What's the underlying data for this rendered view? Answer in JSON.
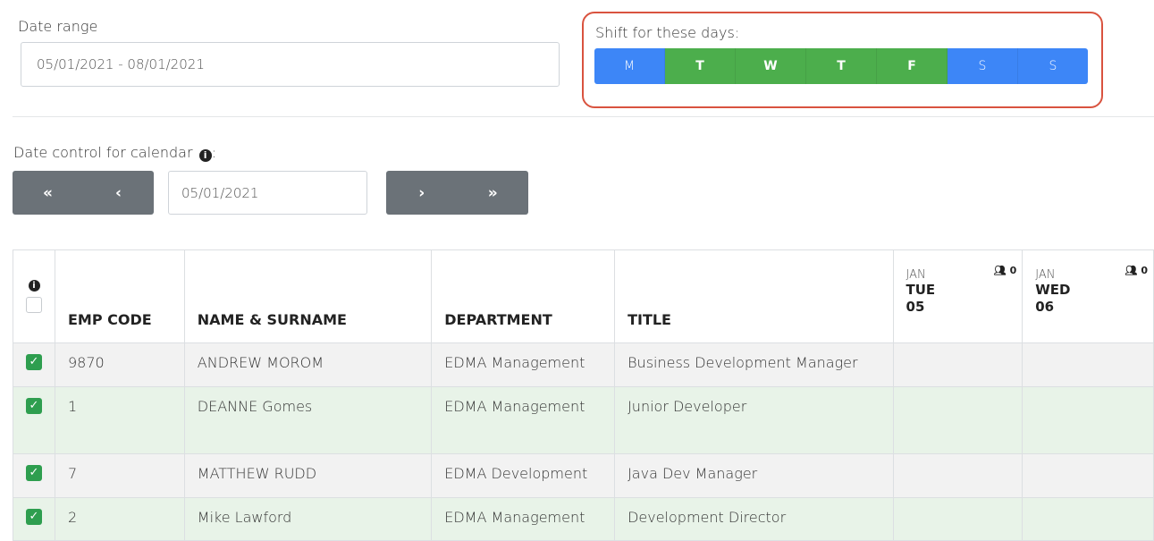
{
  "date_range": {
    "label": "Date range",
    "value": "05/01/2021 - 08/01/2021"
  },
  "shift": {
    "label": "Shift for these days:",
    "days": [
      {
        "label": "M",
        "active": false
      },
      {
        "label": "T",
        "active": true
      },
      {
        "label": "W",
        "active": true
      },
      {
        "label": "T",
        "active": true
      },
      {
        "label": "F",
        "active": true
      },
      {
        "label": "S",
        "active": false
      },
      {
        "label": "S",
        "active": false
      }
    ],
    "highlight_color": "#d9533f",
    "active_color": "#4cae4c",
    "inactive_color": "#3d86f7"
  },
  "calendar": {
    "label": "Date control for calendar",
    "label_suffix": ":",
    "info_icon": "i",
    "value": "05/01/2021",
    "first_label": "«",
    "prev_label": "‹",
    "next_label": "›",
    "last_label": "»"
  },
  "table": {
    "header_info_icon": "i",
    "columns": [
      "EMP CODE",
      "NAME & SURNAME",
      "DEPARTMENT",
      "TITLE"
    ],
    "date_columns": [
      {
        "month": "JAN",
        "dow": "TUE",
        "day": "05",
        "count": "0"
      },
      {
        "month": "JAN",
        "dow": "WED",
        "day": "06",
        "count": "0"
      }
    ],
    "rows": [
      {
        "code": "9870",
        "name": "ANDREW MOROM",
        "department": "EDMA Management",
        "title": "Business Development Manager",
        "checked": true
      },
      {
        "code": "1",
        "name": "DEANNE Gomes",
        "department": "EDMA Management",
        "title": "Junior Developer",
        "checked": true
      },
      {
        "code": "7",
        "name": "MATTHEW RUDD",
        "department": "EDMA Development",
        "title": "Java Dev Manager",
        "checked": true
      },
      {
        "code": "2",
        "name": "Mike Lawford",
        "department": "EDMA Management",
        "title": "Development Director",
        "checked": true
      }
    ]
  }
}
